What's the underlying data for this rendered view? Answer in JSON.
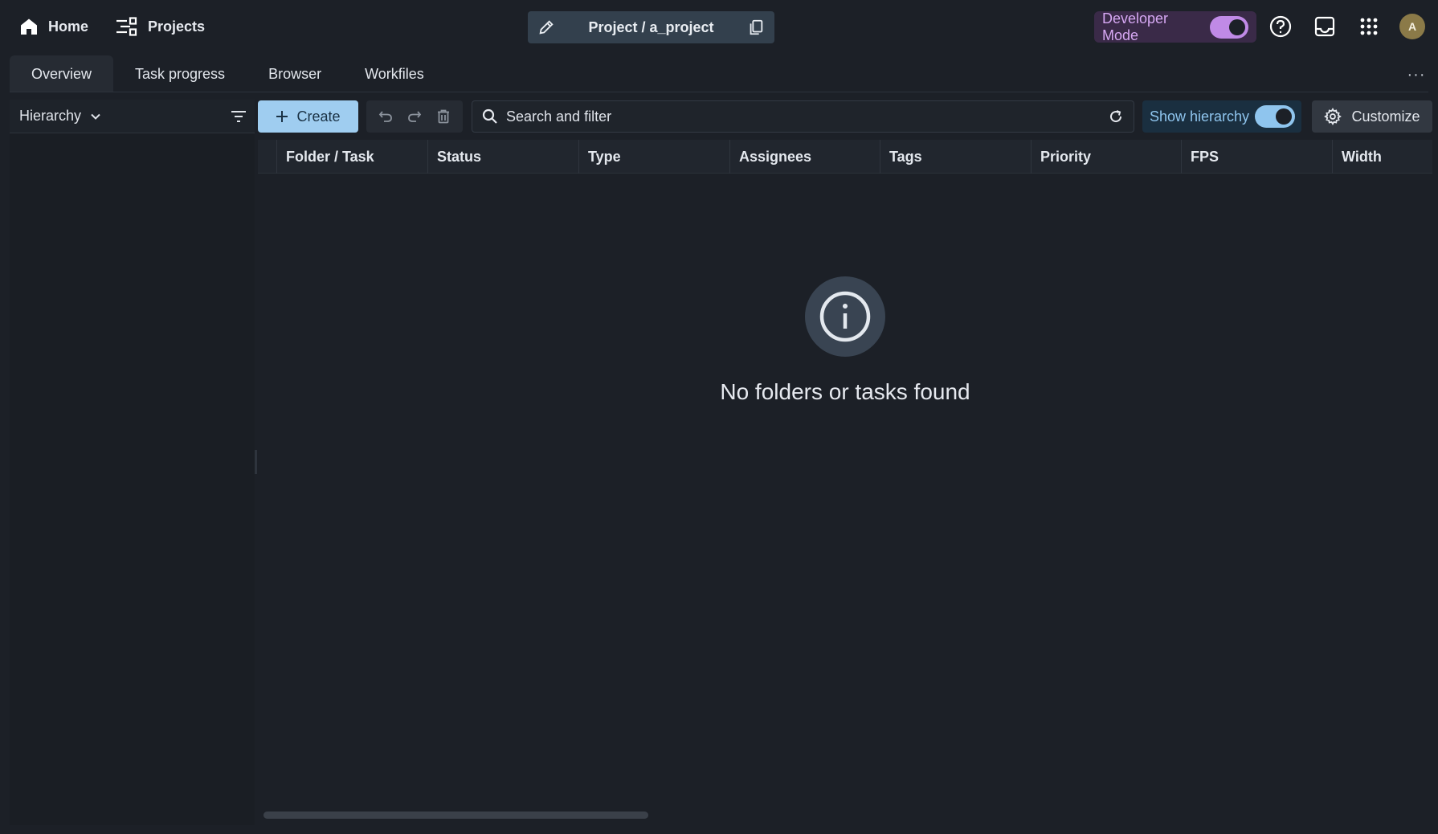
{
  "topbar": {
    "home_label": "Home",
    "projects_label": "Projects",
    "project_path": "Project / a_project",
    "developer_mode_label": "Developer Mode",
    "developer_mode_on": true,
    "avatar_initial": "A",
    "icons": [
      "home-icon",
      "projects-icon",
      "pencil-icon",
      "copy-icon",
      "help-icon",
      "inbox-icon",
      "apps-grid-icon"
    ]
  },
  "tabs": [
    {
      "label": "Overview",
      "active": true
    },
    {
      "label": "Task progress",
      "active": false
    },
    {
      "label": "Browser",
      "active": false
    },
    {
      "label": "Workfiles",
      "active": false
    }
  ],
  "more_label": "···",
  "left_panel": {
    "view_label": "Hierarchy"
  },
  "toolbar": {
    "create_label": "Create",
    "search_placeholder": "Search and filter",
    "show_hierarchy_label": "Show hierarchy",
    "show_hierarchy_on": true,
    "customize_label": "Customize"
  },
  "table": {
    "columns": [
      "Folder / Task",
      "Status",
      "Type",
      "Assignees",
      "Tags",
      "Priority",
      "FPS",
      "Width"
    ],
    "empty_message": "No folders or tasks found"
  },
  "colors": {
    "background": "#1c2027",
    "accent_blue": "#9fcdf0",
    "toggle_blue": "#8fc5ee",
    "toggle_purple": "#c08ae6",
    "avatar": "#8b7a48"
  }
}
